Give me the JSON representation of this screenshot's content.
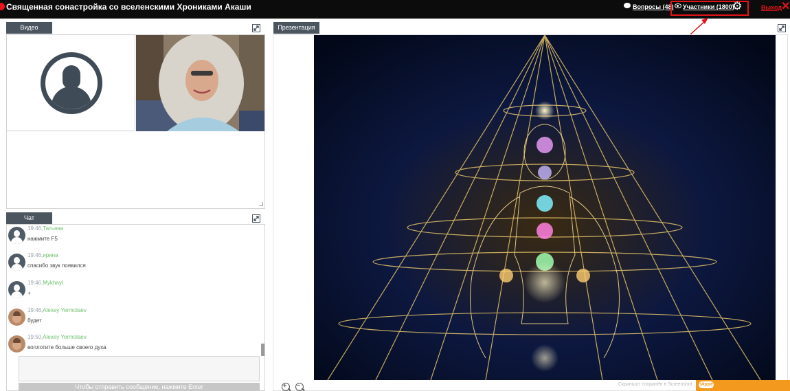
{
  "header": {
    "title": "Священная сонастройка со вселенскими Хрониками Акаши",
    "questions_label": "Вопросы (48)",
    "participants_label": "Участники (1800)",
    "exit_label": "Выход",
    "icons": [
      "record-dot-icon",
      "question-icon",
      "eye-icon",
      "gear-icon",
      "close-icon"
    ],
    "highlight_color": "#e4131a"
  },
  "video": {
    "tab_label": "Видео"
  },
  "chat": {
    "tab_label": "Чат",
    "messages": [
      {
        "time": "19:46,",
        "author": "Татьяна",
        "text": "нажмите F5"
      },
      {
        "time": "19:46,",
        "author": "ирина",
        "text": "спасибо звук появился"
      },
      {
        "time": "19:46,",
        "author": "Mykhayl",
        "text": "+"
      },
      {
        "time": "19:46,",
        "author": "Alexey Yermolaev",
        "text": "будет"
      },
      {
        "time": "19:50,",
        "author": "Alexey Yermolaev",
        "text": "воплотите больше своего духа"
      }
    ],
    "send_hint": "Чтобы отправить сообщение, нажмите Enter",
    "author_color": "#6fbf6f"
  },
  "presentation": {
    "tab_label": "Презентация"
  },
  "footer": {
    "skype_label": "skype",
    "screenshot_note": "Скриншот сохранён в Screenshot"
  }
}
